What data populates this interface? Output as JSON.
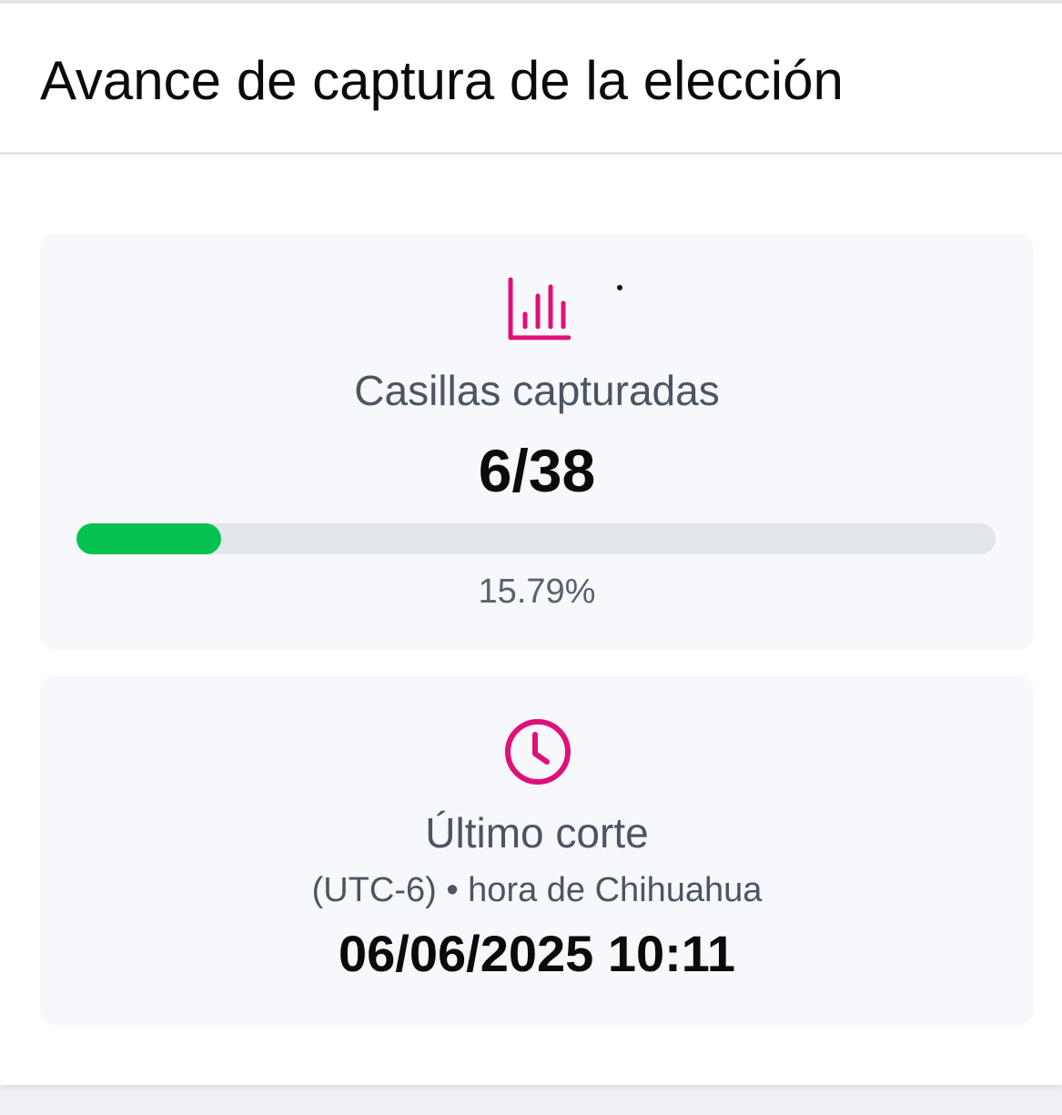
{
  "header": {
    "title": "Avance de captura de la elección"
  },
  "progress_card": {
    "icon": "bar-chart-icon",
    "label": "Casillas capturadas",
    "count": "6/38",
    "percent_text": "15.79%",
    "progress_fraction": 0.1579,
    "accent_color": "#e0107a",
    "bar_color": "#05c150"
  },
  "time_card": {
    "icon": "clock-icon",
    "label": "Último corte",
    "timezone": "(UTC-6) • hora de Chihuahua",
    "datetime": "06/06/2025 10:11",
    "accent_color": "#e0107a"
  }
}
